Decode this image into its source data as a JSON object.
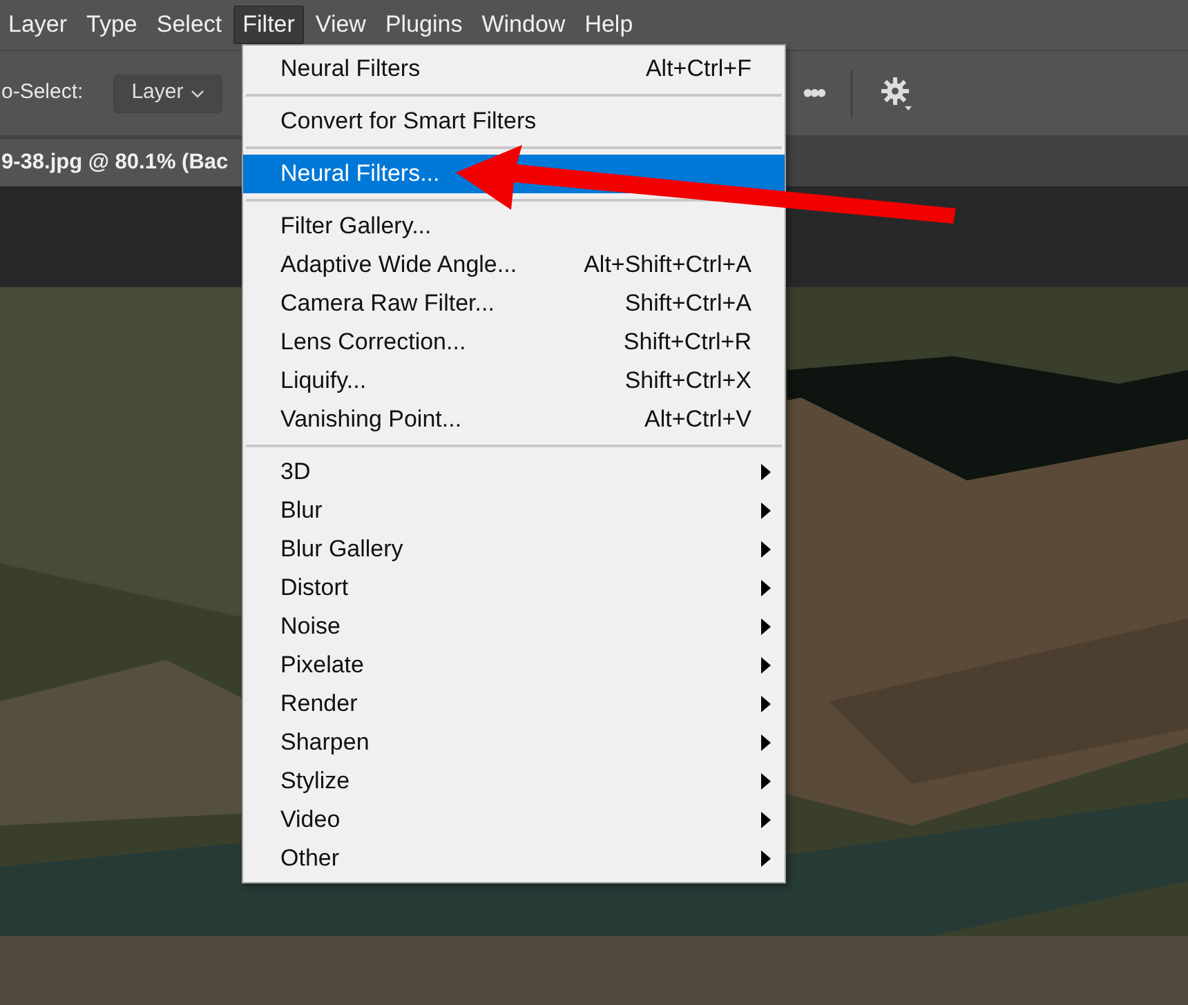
{
  "menu_bar": [
    {
      "label": "Layer",
      "selected": false
    },
    {
      "label": "Type",
      "selected": false
    },
    {
      "label": "Select",
      "selected": false
    },
    {
      "label": "Filter",
      "selected": true
    },
    {
      "label": "View",
      "selected": false
    },
    {
      "label": "Plugins",
      "selected": false
    },
    {
      "label": "Window",
      "selected": false
    },
    {
      "label": "Help",
      "selected": false
    }
  ],
  "options_bar": {
    "auto_select_label": "o-Select:",
    "auto_select_value": "Layer",
    "more": "•••"
  },
  "document_tab": {
    "title": "9-38.jpg @ 80.1% (Bac"
  },
  "filter_menu": [
    {
      "kind": "item",
      "label": "Neural Filters",
      "shortcut": "Alt+Ctrl+F",
      "selected": false
    },
    {
      "kind": "separator"
    },
    {
      "kind": "item",
      "label": "Convert for Smart Filters",
      "selected": false
    },
    {
      "kind": "separator"
    },
    {
      "kind": "item",
      "label": "Neural Filters...",
      "selected": true
    },
    {
      "kind": "separator"
    },
    {
      "kind": "item",
      "label": "Filter Gallery...",
      "selected": false
    },
    {
      "kind": "item",
      "label": "Adaptive Wide Angle...",
      "shortcut": "Alt+Shift+Ctrl+A",
      "selected": false
    },
    {
      "kind": "item",
      "label": "Camera Raw Filter...",
      "shortcut": "Shift+Ctrl+A",
      "selected": false
    },
    {
      "kind": "item",
      "label": "Lens Correction...",
      "shortcut": "Shift+Ctrl+R",
      "selected": false
    },
    {
      "kind": "item",
      "label": "Liquify...",
      "shortcut": "Shift+Ctrl+X",
      "selected": false
    },
    {
      "kind": "item",
      "label": "Vanishing Point...",
      "shortcut": "Alt+Ctrl+V",
      "selected": false
    },
    {
      "kind": "separator"
    },
    {
      "kind": "submenu",
      "label": "3D",
      "selected": false
    },
    {
      "kind": "submenu",
      "label": "Blur",
      "selected": false
    },
    {
      "kind": "submenu",
      "label": "Blur Gallery",
      "selected": false
    },
    {
      "kind": "submenu",
      "label": "Distort",
      "selected": false
    },
    {
      "kind": "submenu",
      "label": "Noise",
      "selected": false
    },
    {
      "kind": "submenu",
      "label": "Pixelate",
      "selected": false
    },
    {
      "kind": "submenu",
      "label": "Render",
      "selected": false
    },
    {
      "kind": "submenu",
      "label": "Sharpen",
      "selected": false
    },
    {
      "kind": "submenu",
      "label": "Stylize",
      "selected": false
    },
    {
      "kind": "submenu",
      "label": "Video",
      "selected": false
    },
    {
      "kind": "submenu",
      "label": "Other",
      "selected": false
    }
  ]
}
